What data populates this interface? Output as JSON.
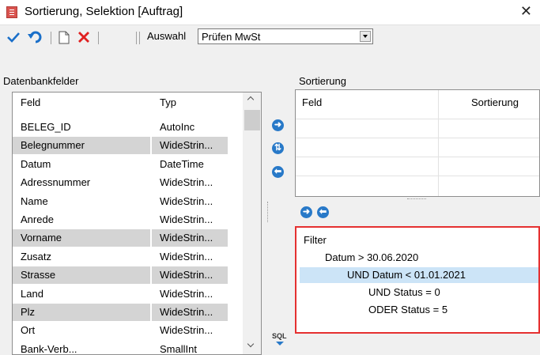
{
  "window": {
    "title": "Sortierung, Selektion [Auftrag]",
    "close_glyph": "✕"
  },
  "toolbar": {
    "auswahl_label": "Auswahl",
    "auswahl_value": "Prüfen MwSt",
    "icons": [
      "check-icon",
      "undo-icon",
      "new-document-icon",
      "delete-icon"
    ],
    "colors": {
      "check": "#1a6fc9",
      "undo": "#1a6fc9",
      "delete": "#e02020"
    }
  },
  "datenbankfelder": {
    "label": "Datenbankfelder",
    "columns": [
      "Feld",
      "Typ"
    ],
    "rows": [
      {
        "feld": "BELEG_ID",
        "typ": "AutoInc",
        "selected": false
      },
      {
        "feld": "Belegnummer",
        "typ": "WideStrin...",
        "selected": true
      },
      {
        "feld": "Datum",
        "typ": "DateTime",
        "selected": false
      },
      {
        "feld": "Adressnummer",
        "typ": "WideStrin...",
        "selected": false
      },
      {
        "feld": "Name",
        "typ": "WideStrin...",
        "selected": false
      },
      {
        "feld": "Anrede",
        "typ": "WideStrin...",
        "selected": false
      },
      {
        "feld": "Vorname",
        "typ": "WideStrin...",
        "selected": true
      },
      {
        "feld": "Zusatz",
        "typ": "WideStrin...",
        "selected": false
      },
      {
        "feld": "Strasse",
        "typ": "WideStrin...",
        "selected": true
      },
      {
        "feld": "Land",
        "typ": "WideStrin...",
        "selected": false
      },
      {
        "feld": "Plz",
        "typ": "WideStrin...",
        "selected": true
      },
      {
        "feld": "Ort",
        "typ": "WideStrin...",
        "selected": false
      },
      {
        "feld": "Bank-Verb...",
        "typ": "SmallInt",
        "selected": false
      }
    ]
  },
  "sortierung": {
    "label": "Sortierung",
    "columns": [
      "Feld",
      "Sortierung"
    ]
  },
  "filter": {
    "lines": [
      {
        "text": "Filter",
        "selected": false
      },
      {
        "text": "Datum > 30.06.2020",
        "selected": false
      },
      {
        "text": "UND Datum < 01.01.2021",
        "selected": true
      },
      {
        "text": "UND Status = 0",
        "selected": false
      },
      {
        "text": "ODER Status = 5",
        "selected": false
      }
    ]
  },
  "sql_label": "SQL",
  "accent_color": "#2879c8",
  "highlight_border": "#e53030"
}
